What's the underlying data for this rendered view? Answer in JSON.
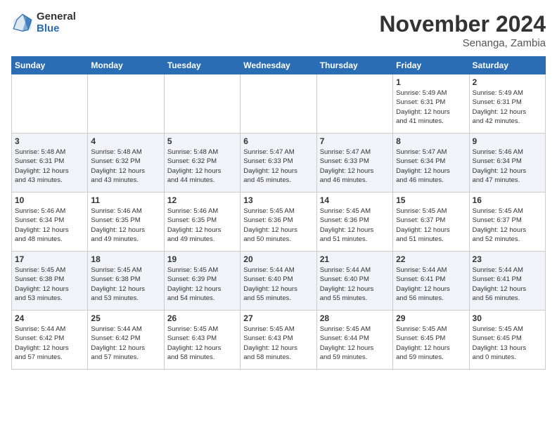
{
  "header": {
    "logo_line1": "General",
    "logo_line2": "Blue",
    "month": "November 2024",
    "location": "Senanga, Zambia"
  },
  "weekdays": [
    "Sunday",
    "Monday",
    "Tuesday",
    "Wednesday",
    "Thursday",
    "Friday",
    "Saturday"
  ],
  "weeks": [
    [
      {
        "day": "",
        "info": ""
      },
      {
        "day": "",
        "info": ""
      },
      {
        "day": "",
        "info": ""
      },
      {
        "day": "",
        "info": ""
      },
      {
        "day": "",
        "info": ""
      },
      {
        "day": "1",
        "info": "Sunrise: 5:49 AM\nSunset: 6:31 PM\nDaylight: 12 hours\nand 41 minutes."
      },
      {
        "day": "2",
        "info": "Sunrise: 5:49 AM\nSunset: 6:31 PM\nDaylight: 12 hours\nand 42 minutes."
      }
    ],
    [
      {
        "day": "3",
        "info": "Sunrise: 5:48 AM\nSunset: 6:31 PM\nDaylight: 12 hours\nand 43 minutes."
      },
      {
        "day": "4",
        "info": "Sunrise: 5:48 AM\nSunset: 6:32 PM\nDaylight: 12 hours\nand 43 minutes."
      },
      {
        "day": "5",
        "info": "Sunrise: 5:48 AM\nSunset: 6:32 PM\nDaylight: 12 hours\nand 44 minutes."
      },
      {
        "day": "6",
        "info": "Sunrise: 5:47 AM\nSunset: 6:33 PM\nDaylight: 12 hours\nand 45 minutes."
      },
      {
        "day": "7",
        "info": "Sunrise: 5:47 AM\nSunset: 6:33 PM\nDaylight: 12 hours\nand 46 minutes."
      },
      {
        "day": "8",
        "info": "Sunrise: 5:47 AM\nSunset: 6:34 PM\nDaylight: 12 hours\nand 46 minutes."
      },
      {
        "day": "9",
        "info": "Sunrise: 5:46 AM\nSunset: 6:34 PM\nDaylight: 12 hours\nand 47 minutes."
      }
    ],
    [
      {
        "day": "10",
        "info": "Sunrise: 5:46 AM\nSunset: 6:34 PM\nDaylight: 12 hours\nand 48 minutes."
      },
      {
        "day": "11",
        "info": "Sunrise: 5:46 AM\nSunset: 6:35 PM\nDaylight: 12 hours\nand 49 minutes."
      },
      {
        "day": "12",
        "info": "Sunrise: 5:46 AM\nSunset: 6:35 PM\nDaylight: 12 hours\nand 49 minutes."
      },
      {
        "day": "13",
        "info": "Sunrise: 5:45 AM\nSunset: 6:36 PM\nDaylight: 12 hours\nand 50 minutes."
      },
      {
        "day": "14",
        "info": "Sunrise: 5:45 AM\nSunset: 6:36 PM\nDaylight: 12 hours\nand 51 minutes."
      },
      {
        "day": "15",
        "info": "Sunrise: 5:45 AM\nSunset: 6:37 PM\nDaylight: 12 hours\nand 51 minutes."
      },
      {
        "day": "16",
        "info": "Sunrise: 5:45 AM\nSunset: 6:37 PM\nDaylight: 12 hours\nand 52 minutes."
      }
    ],
    [
      {
        "day": "17",
        "info": "Sunrise: 5:45 AM\nSunset: 6:38 PM\nDaylight: 12 hours\nand 53 minutes."
      },
      {
        "day": "18",
        "info": "Sunrise: 5:45 AM\nSunset: 6:38 PM\nDaylight: 12 hours\nand 53 minutes."
      },
      {
        "day": "19",
        "info": "Sunrise: 5:45 AM\nSunset: 6:39 PM\nDaylight: 12 hours\nand 54 minutes."
      },
      {
        "day": "20",
        "info": "Sunrise: 5:44 AM\nSunset: 6:40 PM\nDaylight: 12 hours\nand 55 minutes."
      },
      {
        "day": "21",
        "info": "Sunrise: 5:44 AM\nSunset: 6:40 PM\nDaylight: 12 hours\nand 55 minutes."
      },
      {
        "day": "22",
        "info": "Sunrise: 5:44 AM\nSunset: 6:41 PM\nDaylight: 12 hours\nand 56 minutes."
      },
      {
        "day": "23",
        "info": "Sunrise: 5:44 AM\nSunset: 6:41 PM\nDaylight: 12 hours\nand 56 minutes."
      }
    ],
    [
      {
        "day": "24",
        "info": "Sunrise: 5:44 AM\nSunset: 6:42 PM\nDaylight: 12 hours\nand 57 minutes."
      },
      {
        "day": "25",
        "info": "Sunrise: 5:44 AM\nSunset: 6:42 PM\nDaylight: 12 hours\nand 57 minutes."
      },
      {
        "day": "26",
        "info": "Sunrise: 5:45 AM\nSunset: 6:43 PM\nDaylight: 12 hours\nand 58 minutes."
      },
      {
        "day": "27",
        "info": "Sunrise: 5:45 AM\nSunset: 6:43 PM\nDaylight: 12 hours\nand 58 minutes."
      },
      {
        "day": "28",
        "info": "Sunrise: 5:45 AM\nSunset: 6:44 PM\nDaylight: 12 hours\nand 59 minutes."
      },
      {
        "day": "29",
        "info": "Sunrise: 5:45 AM\nSunset: 6:45 PM\nDaylight: 12 hours\nand 59 minutes."
      },
      {
        "day": "30",
        "info": "Sunrise: 5:45 AM\nSunset: 6:45 PM\nDaylight: 13 hours\nand 0 minutes."
      }
    ]
  ]
}
